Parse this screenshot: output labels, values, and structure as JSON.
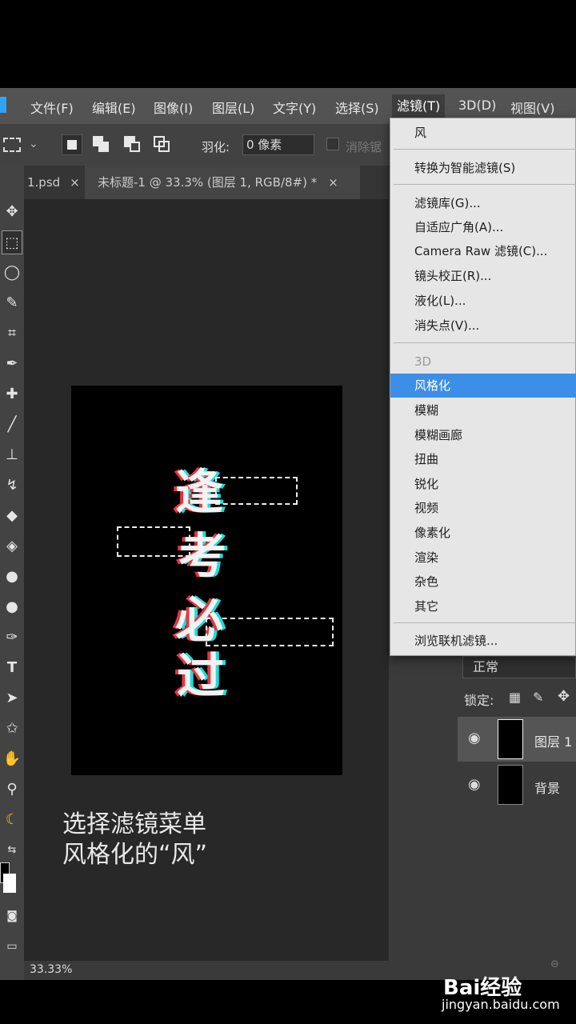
{
  "menubar": {
    "items": [
      "文件(F)",
      "编辑(E)",
      "图像(I)",
      "图层(L)",
      "文字(Y)",
      "选择(S)",
      "滤镜(T)",
      "3D(D)",
      "视图(V)"
    ]
  },
  "optionbar": {
    "feather_label": "羽化:",
    "feather_value": "0 像素",
    "antialias_label": "消除锯"
  },
  "tabs": {
    "prev_tab": "1.psd",
    "active_tab": "未标题-1 @ 33.3% (图层 1, RGB/8#) *"
  },
  "artwork": {
    "chars": [
      "逢",
      "考",
      "必",
      "过"
    ]
  },
  "caption": {
    "line1": "选择滤镜菜单",
    "line2": "风格化的“风”"
  },
  "status": {
    "zoom": "33.33%"
  },
  "filter_menu": {
    "last_filter": "风",
    "smart": "转换为智能滤镜(S)",
    "group1": [
      "滤镜库(G)...",
      "自适应广角(A)...",
      "Camera Raw 滤镜(C)...",
      "镜头校正(R)...",
      "液化(L)...",
      "消失点(V)..."
    ],
    "disabled": "3D",
    "highlighted": "风格化",
    "group2": [
      "模糊",
      "模糊画廊",
      "扭曲",
      "锐化",
      "视频",
      "像素化",
      "渲染",
      "杂色",
      "其它"
    ],
    "browse": "浏览联机滤镜..."
  },
  "layers_panel": {
    "blend_mode": "正常",
    "lock_label": "锁定:",
    "layers": [
      {
        "name": "图层 1",
        "selected": true
      },
      {
        "name": "背景",
        "selected": false
      }
    ]
  },
  "watermark": {
    "brand": "Bai经验",
    "url": "jingyan.baidu.com"
  },
  "colors": {
    "highlight": "#3d8ee6",
    "glitch_red": "#e8343f",
    "glitch_cyan": "#19e0dc"
  }
}
